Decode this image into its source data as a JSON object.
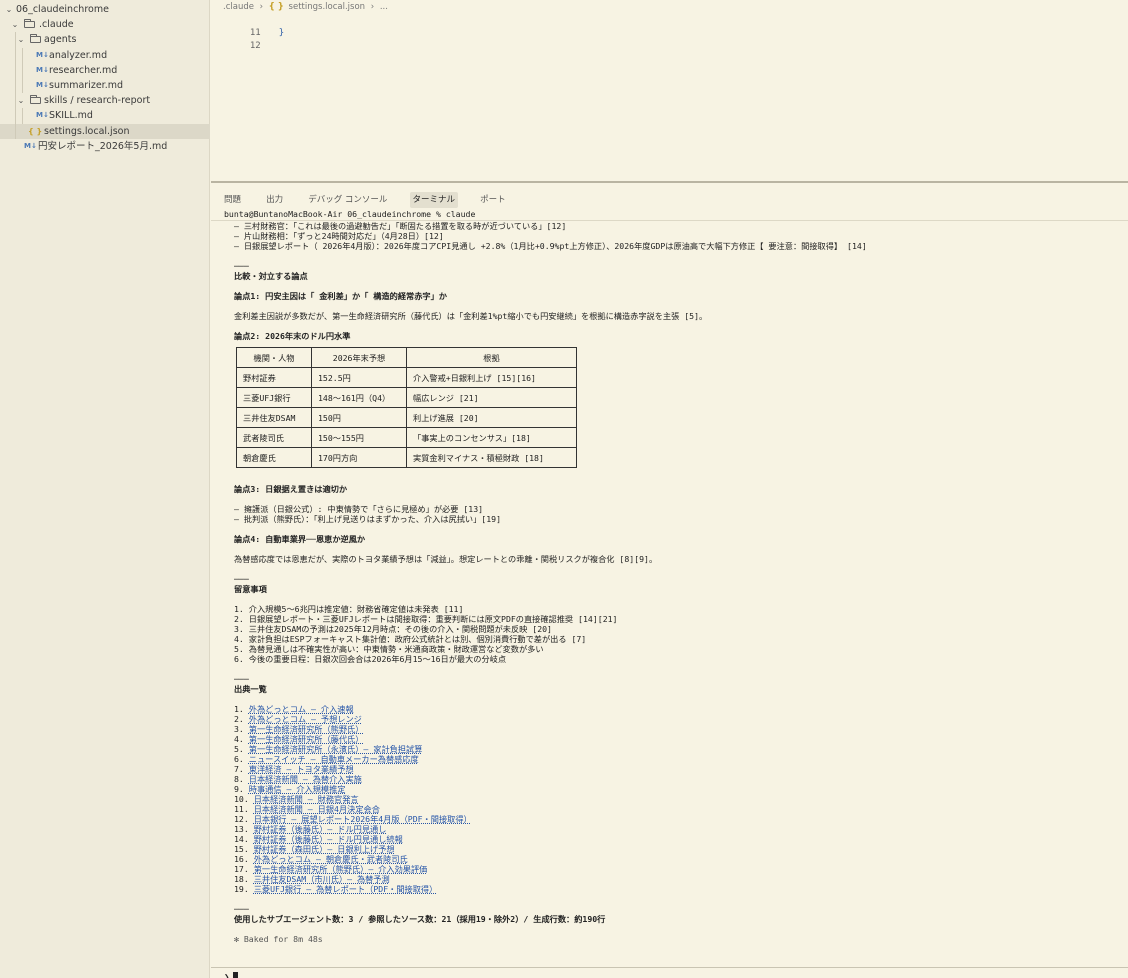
{
  "sidebar": {
    "items": [
      {
        "label": "06_claudeinchrome",
        "kind": "root",
        "chevron": "⌄"
      },
      {
        "label": ".claude",
        "kind": "folder",
        "chevron": "⌄"
      },
      {
        "label": "agents",
        "kind": "folder",
        "chevron": "⌄"
      },
      {
        "label": "analyzer.md",
        "kind": "md"
      },
      {
        "label": "researcher.md",
        "kind": "md"
      },
      {
        "label": "summarizer.md",
        "kind": "md"
      },
      {
        "label": "skills / research-report",
        "kind": "folder",
        "chevron": "⌄"
      },
      {
        "label": "SKILL.md",
        "kind": "md"
      },
      {
        "label": "settings.local.json",
        "kind": "json"
      },
      {
        "label": "円安レポート_2026年5月.md",
        "kind": "md"
      }
    ],
    "md_icon": "M↓",
    "json_icon": "{ }"
  },
  "editor": {
    "breadcrumb": [
      ".claude",
      "settings.local.json",
      "..."
    ],
    "lines": [
      {
        "num": "11",
        "code": "}"
      },
      {
        "num": "12",
        "code": ""
      }
    ]
  },
  "panel": {
    "tabs": [
      "問題",
      "出力",
      "デバッグ コンソール",
      "ターミナル",
      "ポート"
    ],
    "prompt": "bunta@BuntanoMacBook-Air 06_claudeinchrome % claude"
  },
  "terminal": {
    "top_lines": [
      "– 三村財務官：「これは最後の過避勧告だ」「断固たる措置を取る時が近づいている」[12]",
      "– 片山財務相：「ずっと24時間対応だ」（4月28日）[12]",
      "– 日銀展望レポート（ 2026年4月版）：2026年度コアCPI見通し +2.8%（1月比+0.9%pt上方修正）、2026年度GDPは原油高で大幅下方修正【 要注意：間接取得】 [14]"
    ],
    "sep1": "───",
    "section_compare": "比較・対立する論点",
    "issue1_title": "論点1: 円安主因は「 金利差」か「 構造的経常赤字」か",
    "issue1_body": "金利差主因説が多数だが、第一生命経済研究所（藤代氏）は「金利差1%pt縮小でも円安継続」を根拠に構造赤字説を主張 [5]。",
    "issue2_title": "論点2: 2026年末のドル円水準",
    "table": {
      "headers": [
        "機関・人物",
        "2026年末予想",
        "根拠"
      ],
      "rows": [
        [
          "野村証券",
          "152.5円",
          "介入警戒+日銀利上げ [15][16]"
        ],
        [
          "三菱UFJ銀行",
          "148〜161円（Q4）",
          "幅広レンジ [21]"
        ],
        [
          "三井住友DSAM",
          "150円",
          "利上げ進展 [20]"
        ],
        [
          "武者陵司氏",
          "150〜155円",
          "「事実上のコンセンサス」[18]"
        ],
        [
          "朝倉慶氏",
          "170円方向",
          "実質金利マイナス・積極財政 [18]"
        ]
      ]
    },
    "issue3_title": "論点3: 日銀据え置きは適切か",
    "issue3_lines": [
      "– 擁護派（日銀公式）: 中東情勢で「さらに見極め」が必要 [13]",
      "– 批判派（熊野氏）：「利上げ見送りはまずかった、介入は尻拭い」[19]"
    ],
    "issue4_title": "論点4: 自動車業界──恩恵か逆風か",
    "issue4_body": "為替感応度では恩恵だが、実際のトヨタ業績予想は「減益」。想定レートとの乖離・関税リスクが複合化 [8][9]。",
    "sep2": "───",
    "section_notes": "留意事項",
    "notes": [
      "1. 介入規模5〜6兆円は推定値：財務省確定値は未発表 [11]",
      "2. 日銀展望レポート・三菱UFJレポートは間接取得：重要判断には原文PDFの直接確認推奨 [14][21]",
      "3. 三井住友DSAMの予測は2025年12月時点：その後の介入・関税問題が未反映 [20]",
      "4. 家計負担はESPフォーキャスト集計値：政府公式統計とは別、個別消費行動で差が出る [7]",
      "5. 為替見通しは不確実性が高い：中東情勢・米通商政策・財政運営など変数が多い",
      "6. 今後の重要日程：日銀次回会合は2026年6月15〜16日が最大の分岐点"
    ],
    "sep3": "───",
    "section_sources": "出典一覧",
    "sources": [
      {
        "n": "1.",
        "text": "外為どっとコム ― 介入速報"
      },
      {
        "n": "2.",
        "text": "外為どっとコム ― 予想レンジ"
      },
      {
        "n": "3.",
        "text": "第一生命経済研究所（熊野氏）"
      },
      {
        "n": "4.",
        "text": "第一生命経済研究所（藤代氏）"
      },
      {
        "n": "5.",
        "text": "第一生命経済研究所（永濱氏）― 家計負担試算"
      },
      {
        "n": "6.",
        "text": "ニュースイッチ ― 自動車メーカー為替感応度"
      },
      {
        "n": "7.",
        "text": "東洋経済 ― トヨタ業績予想"
      },
      {
        "n": "8.",
        "text": "日本経済新聞 ― 為替介入実施"
      },
      {
        "n": "9.",
        "text": "時事通信 ― 介入規模推定"
      },
      {
        "n": "10.",
        "text": "日本経済新聞 ― 財務官発言"
      },
      {
        "n": "11.",
        "text": "日本経済新聞 ― 日銀4月決定会合"
      },
      {
        "n": "12.",
        "text": "日本銀行 ― 展望レポート2026年4月版（PDF・間接取得）"
      },
      {
        "n": "13.",
        "text": "野村証券（後藤氏）― ドル円見通し"
      },
      {
        "n": "14.",
        "text": "野村証券（後藤氏）― ドル円見通し続報"
      },
      {
        "n": "15.",
        "text": "野村証券（森田氏）― 日銀利上げ予想"
      },
      {
        "n": "16.",
        "text": "外為どっとコム ― 朝倉慶氏・武者陵司氏"
      },
      {
        "n": "17.",
        "text": "第一生命経済研究所（熊野氏）― 介入効果評価"
      },
      {
        "n": "18.",
        "text": "三井住友DSAM（市川氏）― 為替予測"
      },
      {
        "n": "19.",
        "text": "三菱UFJ銀行 ― 為替レポート（PDF・間接取得）"
      }
    ],
    "sep4": "───",
    "summary": "使用したサブエージェント数：3 / 参照したソース数：21（採用19・除外2）/ 生成行数：約190行",
    "baked": "✻ Baked for 8m 48s",
    "input_prompt": "❯"
  }
}
